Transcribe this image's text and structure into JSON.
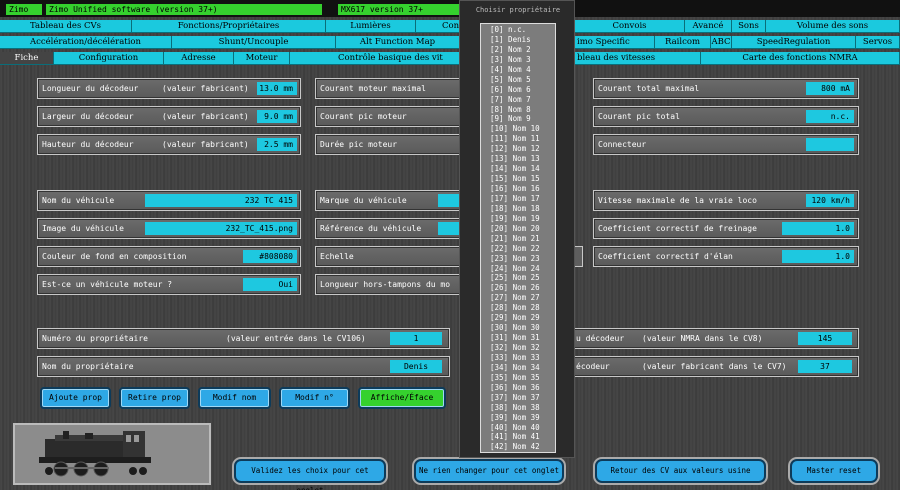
{
  "titlebar": {
    "zimo": "Zimo",
    "software": "Zimo Unified software (version 37+)",
    "decoder": "MX617 version 37+"
  },
  "tabs_row1": [
    "Tableau des CVs",
    "Fonctions/Propriétaires",
    "Lumières",
    "Con",
    "Convois",
    "Avancé",
    "Sons",
    "Volume des sons"
  ],
  "tabs_row2": [
    "Accélération/décélération",
    "Shunt/Uncouple",
    "Alt Function Map",
    "imo Specific",
    "Railcom",
    "ABC",
    "SpeedRegulation",
    "Servos"
  ],
  "tabs_row3": [
    "Fiche",
    "Configuration",
    "Adresse",
    "Moteur",
    "Contrôle basique des vit",
    "bleau des vitesses",
    "Carte des fonctions NMRA"
  ],
  "fields": {
    "longueur": {
      "label": "Longueur du décodeur",
      "sub": "(valeur fabricant)",
      "value": "13.0 mm"
    },
    "largeur": {
      "label": "Largeur du décodeur",
      "sub": "(valeur fabricant)",
      "value": "9.0 mm"
    },
    "hauteur": {
      "label": "Hauteur du décodeur",
      "sub": "(valeur fabricant)",
      "value": "2.5 mm"
    },
    "courant_moteur": {
      "label": "Courant moteur maximal"
    },
    "courant_pic_moteur": {
      "label": "Courant pic moteur"
    },
    "duree_pic": {
      "label": "Durée pic moteur"
    },
    "courant_total": {
      "label": "Courant total maximal",
      "value": "800 mA"
    },
    "courant_pic_total": {
      "label": "Courant pic total",
      "value": "n.c."
    },
    "connecteur": {
      "label": "Connecteur",
      "value": ""
    },
    "nom_vehicule": {
      "label": "Nom du véhicule",
      "value": "232 TC 415"
    },
    "image_vehicule": {
      "label": "Image du véhicule",
      "value": "232_TC_415.png"
    },
    "couleur_fond": {
      "label": "Couleur de fond en composition",
      "value": "#808080"
    },
    "vehicule_moteur": {
      "label": "Est-ce un véhicule moteur ?",
      "value": "Oui"
    },
    "marque": {
      "label": "Marque du véhicule"
    },
    "reference": {
      "label": "Référence du véhicule"
    },
    "echelle": {
      "label": "Echelle"
    },
    "longueur_ht": {
      "label": "Longueur hors-tampons du mo"
    },
    "vitesse_max": {
      "label": "Vitesse maximale de la vraie loco",
      "value": "120 km/h"
    },
    "coef_freinage": {
      "label": "Coefficient correctif de freinage",
      "value": "1.0"
    },
    "coef_elan": {
      "label": "Coefficient correctif d'élan",
      "value": "1.0"
    },
    "num_proprio": {
      "label": "Numéro du propriétaire",
      "sub": "(valeur entrée dans le CV106)",
      "value": "1"
    },
    "nom_proprio": {
      "label": "Nom du propriétaire",
      "value": "Denis"
    },
    "cv8": {
      "label": "u décodeur",
      "sub": "(valeur NMRA dans le CV8)",
      "value": "145"
    },
    "cv7": {
      "label": "écodeur",
      "sub": "(valeur fabricant dans le CV7)",
      "value": "37"
    }
  },
  "owner_buttons": {
    "ajoute": "Ajoute prop",
    "retire": "Retire prop",
    "modif_nom": "Modif nom",
    "modif_num": "Modif n°",
    "affiche": "Affiche/Éface"
  },
  "bottom_buttons": {
    "valider": "Validez les choix pour cet onglet",
    "ne_rien": "Ne rien changer pour cet onglet",
    "retour": "Retour des CV aux valeurs usine",
    "reset": "Master reset"
  },
  "popup": {
    "title": "Choisir propriétaire",
    "items": [
      "[0] n.c.",
      "[1] Denis",
      "[2] Nom 2",
      "[3] Nom 3",
      "[4] Nom 4",
      "[5] Nom 5",
      "[6] Nom 6",
      "[7] Nom 7",
      "[8] Nom 8",
      "[9] Nom 9",
      "[10] Nom 10",
      "[11] Nom 11",
      "[12] Nom 12",
      "[13] Nom 13",
      "[14] Nom 14",
      "[15] Nom 15",
      "[16] Nom 16",
      "[17] Nom 17",
      "[18] Nom 18",
      "[19] Nom 19",
      "[20] Nom 20",
      "[21] Nom 21",
      "[22] Nom 22",
      "[23] Nom 23",
      "[24] Nom 24",
      "[25] Nom 25",
      "[26] Nom 26",
      "[27] Nom 27",
      "[28] Nom 28",
      "[29] Nom 29",
      "[30] Nom 30",
      "[31] Nom 31",
      "[32] Nom 32",
      "[33] Nom 33",
      "[34] Nom 34",
      "[35] Nom 35",
      "[36] Nom 36",
      "[37] Nom 37",
      "[38] Nom 38",
      "[39] Nom 39",
      "[40] Nom 40",
      "[41] Nom 41",
      "[42] Nom 42"
    ]
  },
  "colors": {
    "accent": "#1ec8e0",
    "status_green": "#35d12e",
    "button_blue": "#2ea8e6"
  }
}
